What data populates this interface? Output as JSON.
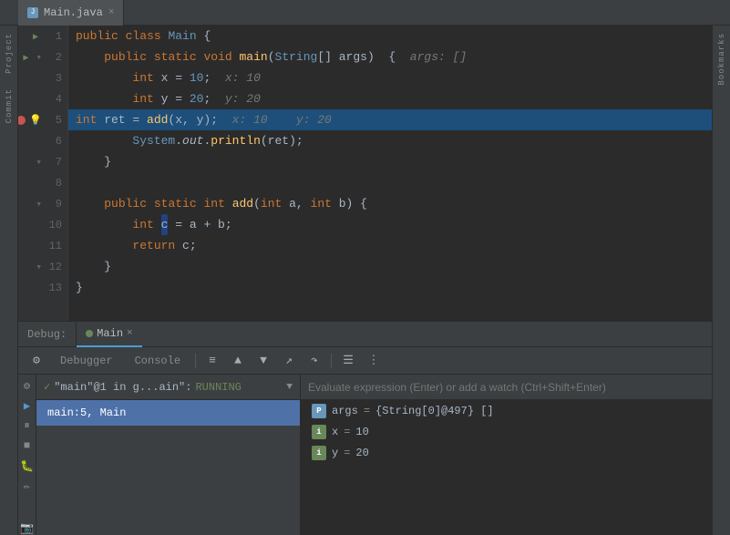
{
  "tab": {
    "icon": "J",
    "label": "Main.java",
    "close": "×"
  },
  "sidebar": {
    "project_label": "Project",
    "commit_label": "Commit"
  },
  "lines": [
    {
      "num": 1,
      "has_run": true,
      "content": "public_class_main",
      "indent": 0
    },
    {
      "num": 2,
      "has_run": true,
      "has_fold": true,
      "content": "public_static_void_main",
      "indent": 1
    },
    {
      "num": 3,
      "content": "int_x_10",
      "indent": 2
    },
    {
      "num": 4,
      "content": "int_y_20",
      "indent": 2
    },
    {
      "num": 5,
      "is_current": true,
      "has_breakpoint": true,
      "has_lightbulb": true,
      "content": "int_ret_add",
      "indent": 2
    },
    {
      "num": 6,
      "content": "system_out",
      "indent": 2
    },
    {
      "num": 7,
      "has_fold": true,
      "content": "close_brace",
      "indent": 1
    },
    {
      "num": 8,
      "content": "empty",
      "indent": 0
    },
    {
      "num": 9,
      "has_fold": true,
      "content": "public_static_int_add",
      "indent": 1
    },
    {
      "num": 10,
      "content": "int_c_a_b",
      "indent": 2
    },
    {
      "num": 11,
      "content": "return_c",
      "indent": 2
    },
    {
      "num": 12,
      "has_fold": true,
      "content": "close_brace2",
      "indent": 1
    },
    {
      "num": 13,
      "content": "close_brace3",
      "indent": 0
    }
  ],
  "debug": {
    "panel_label": "Debug:",
    "tab_name": "Main",
    "tab_close": "×",
    "tabs": {
      "debugger": "Debugger",
      "console": "Console"
    },
    "toolbar_icons": [
      "⚙",
      "≡",
      "↑",
      "↓",
      "↗",
      "☰",
      "⋮"
    ],
    "status": {
      "check": "✓",
      "thread": "\"main\"@1 in g...ain\":",
      "state": "RUNNING",
      "filter_icon": "▼"
    },
    "frame": "main:5, Main",
    "vars_placeholder": "Evaluate expression (Enter) or add a watch (Ctrl+Shift+Enter)",
    "variables": [
      {
        "badge": "P",
        "badge_type": "arr",
        "name": "args",
        "eq": "=",
        "value": "{String[0]@497} []"
      },
      {
        "badge": "i",
        "badge_type": "int",
        "name": "x",
        "eq": "=",
        "value": "10"
      },
      {
        "badge": "i",
        "badge_type": "int",
        "name": "y",
        "eq": "=",
        "value": "20"
      }
    ]
  },
  "bottom_sidebar": {
    "label": "Bookmarks"
  },
  "colors": {
    "accent_blue": "#4e9bd1",
    "keyword": "#cc7832",
    "function": "#ffc66d",
    "string": "#6a8759",
    "number": "#6897bb",
    "comment": "#808080",
    "breakpoint_red": "#c75450",
    "current_line": "#1d4f7a",
    "selected_frame": "#4e71a8"
  }
}
